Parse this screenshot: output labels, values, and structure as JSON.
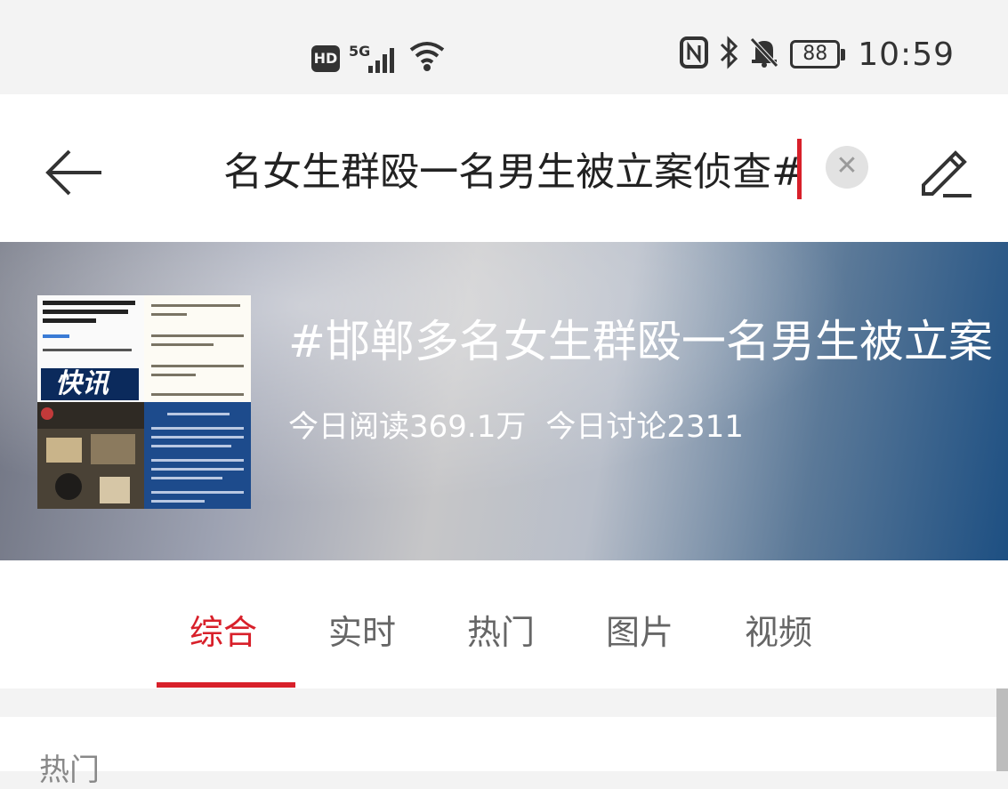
{
  "status_bar": {
    "hd_label": "HD",
    "network_label": "5G",
    "battery_level": "88",
    "time": "10:59",
    "icons": [
      "hd-icon",
      "signal-icon",
      "wifi-icon",
      "nfc-icon",
      "bluetooth-icon",
      "mute-bell-icon",
      "battery-icon"
    ]
  },
  "search": {
    "query_visible": "名女生群殴一名男生被立案侦查#",
    "clear_label": "✕"
  },
  "topic": {
    "title": "#邯郸多名女生群殴一名男生被立案",
    "reads": "今日阅读369.1万",
    "discussions": "今日讨论2311",
    "thumbnail_badge": "快讯"
  },
  "tabs": [
    {
      "label": "综合",
      "active": true
    },
    {
      "label": "实时",
      "active": false
    },
    {
      "label": "热门",
      "active": false
    },
    {
      "label": "图片",
      "active": false
    },
    {
      "label": "视频",
      "active": false
    }
  ],
  "section": {
    "label": "热门"
  },
  "colors": {
    "accent": "#d8202a"
  }
}
